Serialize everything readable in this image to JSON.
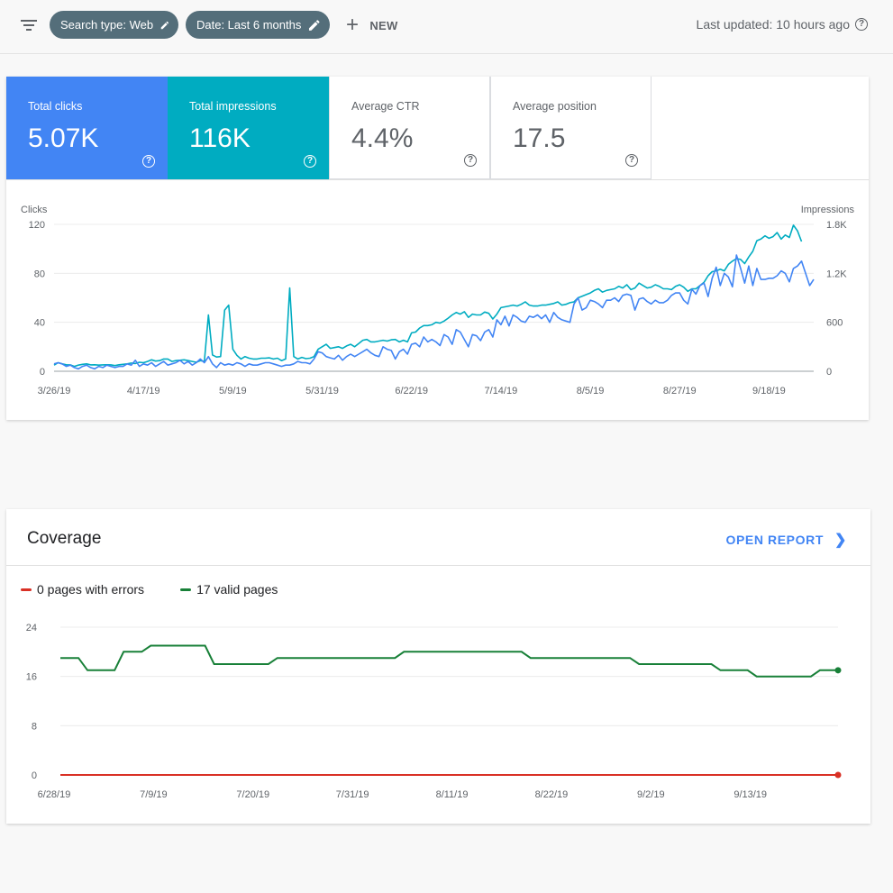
{
  "toolbar": {
    "filter_icon": "filter-list-icon",
    "chips": [
      {
        "label": "Search type: Web",
        "icon": "pencil-icon"
      },
      {
        "label": "Date: Last 6 months",
        "icon": "pencil-icon"
      }
    ],
    "new_label": "NEW",
    "last_updated": "Last updated: 10 hours ago"
  },
  "metrics": [
    {
      "label": "Total clicks",
      "value": "5.07K",
      "color": "#4285f4"
    },
    {
      "label": "Total impressions",
      "value": "116K",
      "color": "#00acc1"
    },
    {
      "label": "Average CTR",
      "value": "4.4%"
    },
    {
      "label": "Average position",
      "value": "17.5"
    }
  ],
  "coverage": {
    "title": "Coverage",
    "open_report_label": "OPEN REPORT",
    "legend": [
      {
        "label": "0 pages with errors",
        "color": "#d93025"
      },
      {
        "label": "17 valid pages",
        "color": "#188038"
      }
    ]
  },
  "chart_data": [
    {
      "type": "line",
      "ylabel_left": "Clicks",
      "ylabel_right": "Impressions",
      "y_left_ticks": [
        "0",
        "40",
        "80",
        "120"
      ],
      "y_left_lim": [
        0,
        120
      ],
      "y_right_ticks": [
        "0",
        "600",
        "1.2K",
        "1.8K"
      ],
      "y_right_lim": [
        0,
        1800
      ],
      "x_tick_labels": [
        "3/26/19",
        "4/17/19",
        "5/9/19",
        "5/31/19",
        "6/22/19",
        "7/14/19",
        "8/5/19",
        "8/27/19",
        "9/18/19"
      ],
      "x_index_of_ticks": [
        0,
        22,
        44,
        66,
        88,
        110,
        132,
        154,
        176
      ],
      "grid": true,
      "series": [
        {
          "name": "Clicks",
          "color": "#4285f4",
          "axis": "left",
          "values": [
            6,
            7,
            6,
            4,
            5,
            3,
            2,
            4,
            5,
            3,
            2,
            4,
            3,
            5,
            4,
            3,
            4,
            4,
            6,
            5,
            9,
            4,
            6,
            5,
            7,
            4,
            6,
            8,
            5,
            6,
            7,
            9,
            6,
            8,
            5,
            7,
            10,
            7,
            12,
            6,
            3,
            7,
            5,
            6,
            5,
            7,
            6,
            4,
            6,
            5,
            5,
            6,
            7,
            7,
            6,
            5,
            4,
            5,
            5,
            6,
            8,
            7,
            7,
            6,
            10,
            16,
            15,
            12,
            11,
            10,
            13,
            9,
            12,
            14,
            12,
            14,
            16,
            18,
            15,
            13,
            12,
            20,
            18,
            17,
            10,
            16,
            18,
            14,
            22,
            23,
            20,
            28,
            24,
            26,
            24,
            21,
            30,
            28,
            22,
            34,
            32,
            26,
            20,
            30,
            29,
            25,
            32,
            34,
            28,
            42,
            38,
            45,
            37,
            46,
            44,
            41,
            40,
            45,
            44,
            46,
            43,
            46,
            40,
            48,
            44,
            42,
            41,
            40,
            55,
            60,
            50,
            52,
            58,
            57,
            55,
            52,
            58,
            58,
            60,
            57,
            62,
            63,
            62,
            50,
            59,
            60,
            57,
            55,
            58,
            56,
            56,
            58,
            62,
            64,
            64,
            58,
            55,
            67,
            63,
            70,
            72,
            61,
            76,
            85,
            70,
            80,
            77,
            69,
            95,
            84,
            72,
            86,
            70,
            84,
            75,
            75,
            76,
            76,
            78,
            82,
            80,
            73,
            84,
            86,
            90,
            80,
            70,
            75
          ]
        },
        {
          "name": "Impressions",
          "color": "#00acc1",
          "axis": "right",
          "values": [
            75,
            105,
            90,
            80,
            78,
            60,
            75,
            85,
            90,
            78,
            80,
            75,
            78,
            80,
            78,
            70,
            80,
            85,
            90,
            100,
            95,
            110,
            105,
            120,
            140,
            125,
            130,
            150,
            150,
            120,
            130,
            135,
            140,
            130,
            120,
            110,
            130,
            120,
            690,
            200,
            175,
            180,
            750,
            810,
            270,
            195,
            150,
            180,
            160,
            150,
            150,
            160,
            160,
            165,
            150,
            160,
            130,
            150,
            1020,
            180,
            150,
            170,
            155,
            160,
            180,
            270,
            300,
            330,
            280,
            290,
            300,
            280,
            310,
            330,
            300,
            340,
            380,
            390,
            360,
            360,
            370,
            380,
            370,
            385,
            390,
            360,
            380,
            360,
            470,
            480,
            530,
            560,
            560,
            570,
            600,
            590,
            615,
            650,
            690,
            720,
            700,
            730,
            660,
            700,
            690,
            690,
            725,
            710,
            640,
            700,
            780,
            790,
            800,
            810,
            800,
            820,
            850,
            810,
            800,
            800,
            810,
            810,
            820,
            830,
            850,
            810,
            820,
            840,
            850,
            900,
            920,
            940,
            960,
            990,
            1010,
            970,
            990,
            1000,
            1010,
            1040,
            1020,
            1060,
            1000,
            1020,
            1080,
            1050,
            1020,
            1030,
            1060,
            1040,
            1010,
            1010,
            1000,
            1040,
            1060,
            1030,
            980,
            1010,
            1010,
            1050,
            1090,
            1170,
            1220,
            1230,
            1250,
            1230,
            1310,
            1350,
            1380,
            1370,
            1320,
            1400,
            1470,
            1600,
            1620,
            1660,
            1630,
            1650,
            1700,
            1620,
            1670,
            1640,
            1790,
            1720,
            1590
          ]
        }
      ]
    },
    {
      "type": "line",
      "y_ticks": [
        "0",
        "8",
        "16",
        "24"
      ],
      "ylim": [
        0,
        24
      ],
      "x_tick_labels": [
        "6/28/19",
        "7/9/19",
        "7/20/19",
        "7/31/19",
        "8/11/19",
        "8/22/19",
        "9/2/19",
        "9/13/19"
      ],
      "x_tick_days": [
        0,
        11,
        22,
        33,
        44,
        55,
        66,
        77
      ],
      "x_last_day": 86,
      "grid": true,
      "series": [
        {
          "name": "0 pages with errors",
          "color": "#d93025",
          "points": [
            [
              0,
              0
            ],
            [
              86,
              0
            ]
          ]
        },
        {
          "name": "17 valid pages",
          "color": "#188038",
          "points": [
            [
              0,
              19
            ],
            [
              2,
              19
            ],
            [
              3,
              17
            ],
            [
              6,
              17
            ],
            [
              7,
              20
            ],
            [
              9,
              20
            ],
            [
              10,
              21
            ],
            [
              16,
              21
            ],
            [
              17,
              18
            ],
            [
              23,
              18
            ],
            [
              24,
              19
            ],
            [
              37,
              19
            ],
            [
              38,
              20
            ],
            [
              51,
              20
            ],
            [
              52,
              19
            ],
            [
              63,
              19
            ],
            [
              64,
              18
            ],
            [
              72,
              18
            ],
            [
              73,
              17
            ],
            [
              76,
              17
            ],
            [
              77,
              16
            ],
            [
              83,
              16
            ],
            [
              84,
              17
            ],
            [
              86,
              17
            ]
          ]
        }
      ]
    }
  ]
}
